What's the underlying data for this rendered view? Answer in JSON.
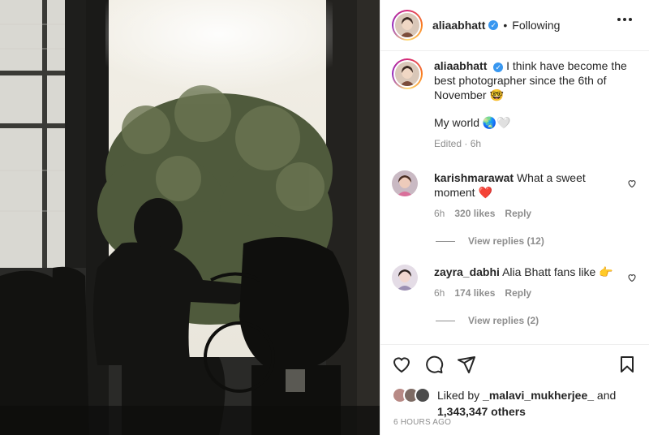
{
  "post": {
    "author": "aliaabhatt",
    "verified_mark": "✓",
    "separator": "•",
    "follow_status": "Following",
    "more_icon": "more-horizontal-icon"
  },
  "caption": {
    "author": "aliaabhatt",
    "text": "I think have become the best photographer since the 6th of November 🤓",
    "text2": "My world 🌏🤍",
    "edited": "Edited · 6h"
  },
  "comments": [
    {
      "user": "karishmarawat",
      "text": "What a sweet moment ❤️",
      "time": "6h",
      "likes": "320 likes",
      "reply": "Reply",
      "view_replies": "View replies (12)"
    },
    {
      "user": "zayra_dabhi",
      "text": "Alia Bhatt fans like 👉",
      "time": "6h",
      "likes": "174 likes",
      "reply": "Reply",
      "view_replies": "View replies (2)"
    }
  ],
  "actions": {
    "like_icon": "heart-icon",
    "comment_icon": "comment-icon",
    "share_icon": "share-icon",
    "save_icon": "bookmark-icon"
  },
  "likes": {
    "prefix": "Liked by",
    "user": "_malavi_mukherjee_",
    "conj": "and",
    "count": "1,343,347 others"
  },
  "timestamp": "6 HOURS AGO",
  "colors": {
    "verified": "#3897f0",
    "heart": "#ed4956",
    "muted": "#8e8e8e"
  }
}
